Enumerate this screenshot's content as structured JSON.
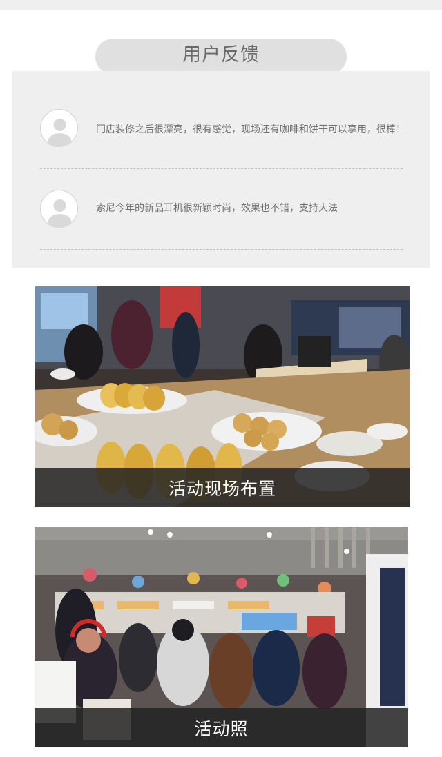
{
  "section": {
    "title": "用户反馈"
  },
  "feedback": [
    {
      "avatar_icon": "user-avatar-icon",
      "text": "门店装修之后很漂亮，很有感觉，现场还有咖啡和饼干可以享用，很棒！"
    },
    {
      "avatar_icon": "user-avatar-icon",
      "text": "索尼今年的新品耳机很新颖时尚，效果也不错，支持大法"
    }
  ],
  "photos": [
    {
      "caption": "活动现场布置",
      "image_alt": "活动现场布置"
    },
    {
      "caption": "活动照",
      "image_alt": "活动照"
    }
  ],
  "colors": {
    "page_bg": "#ffffff",
    "panel_bg": "#efefef",
    "pill_bg": "#e0e0e0",
    "caption_bg": "#232323",
    "text": "#6f6f6f"
  }
}
